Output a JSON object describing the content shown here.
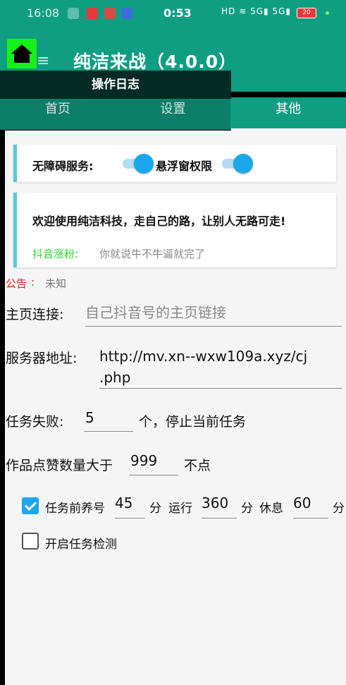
{
  "status_bar": {
    "time": "16:08",
    "center_time": "0:53",
    "right_icons": "HD ≋ 5G▮ 5G▮",
    "battery": "20"
  },
  "app": {
    "title": "纯洁来战（4.0.0）",
    "home_icon": "home-icon",
    "log_button": "操作日志"
  },
  "tabs": [
    {
      "label": "首页"
    },
    {
      "label": "设置"
    },
    {
      "label": "其他"
    }
  ],
  "card1": {
    "accessibility_label": "无障碍服务:",
    "accessibility_on": true,
    "float_label": "悬浮窗权限",
    "float_on": true
  },
  "card2": {
    "welcome": "欢迎使用纯洁科技，走自己的路，让别人无路可走!",
    "douyin_label": "抖音涨粉:",
    "douyin_text": "你就说牛不牛逼就完了"
  },
  "notice": {
    "label": "公告",
    "colon": ":",
    "value": "未知"
  },
  "homepage": {
    "label": "主页连接:",
    "placeholder": "自己抖音号的主页链接"
  },
  "server": {
    "label": "服务器地址:",
    "value_line1": "http://mv.xn--wxw109a.xyz/cj",
    "value_line2": ".php"
  },
  "task_fail": {
    "label": "任务失败:",
    "value": "5",
    "suffix": "个，停止当前任务"
  },
  "likes": {
    "label": "作品点赞数量大于",
    "value": "999",
    "suffix": "不点"
  },
  "schedule": {
    "checked": true,
    "label": "任务前养号",
    "raise_value": "45",
    "unit1": "分",
    "run_label": "运行",
    "run_value": "360",
    "unit2": "分",
    "rest_label": "休息",
    "rest_value": "60",
    "unit3": "分"
  },
  "detect": {
    "checked": false,
    "label": "开启任务检测"
  },
  "colors": {
    "primary": "#0f9e82",
    "accent": "#1ba7ec",
    "notice_red": "#e0201a",
    "douyin_green": "#2ed42e"
  }
}
